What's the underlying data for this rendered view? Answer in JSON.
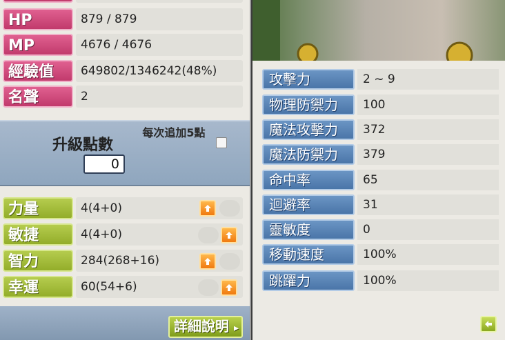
{
  "basic_stats": [
    {
      "label": "HP",
      "value": "879 / 879"
    },
    {
      "label": "MP",
      "value": "4676 / 4676"
    },
    {
      "label": "經驗值",
      "value": "649802/1346242(48%)"
    },
    {
      "label": "名聲",
      "value": "2"
    }
  ],
  "level_points": {
    "label": "升級點數",
    "value": "0",
    "auto_label": "每次追加5點",
    "auto_checked": false
  },
  "attributes": [
    {
      "label": "力量",
      "value": "4(4+0)"
    },
    {
      "label": "敏捷",
      "value": "4(4+0)"
    },
    {
      "label": "智力",
      "value": "284(268+16)"
    },
    {
      "label": "幸運",
      "value": "60(54+6)"
    }
  ],
  "detail_button": "詳細說明",
  "detail_stats": [
    {
      "label": "攻擊力",
      "value": "2 ~ 9"
    },
    {
      "label": "物理防禦力",
      "value": "100"
    },
    {
      "label": "魔法攻擊力",
      "value": "372"
    },
    {
      "label": "魔法防禦力",
      "value": "379"
    },
    {
      "label": "命中率",
      "value": "65"
    },
    {
      "label": "迴避率",
      "value": "31"
    },
    {
      "label": "靈敏度",
      "value": "0"
    },
    {
      "label": "移動速度",
      "value": "100%"
    },
    {
      "label": "跳躍力",
      "value": "100%"
    }
  ],
  "colors": {
    "stat_pink": "#c13a6c",
    "attr_green": "#93ad2a",
    "detail_blue": "#4a75a8",
    "up_orange": "#f07a10"
  }
}
